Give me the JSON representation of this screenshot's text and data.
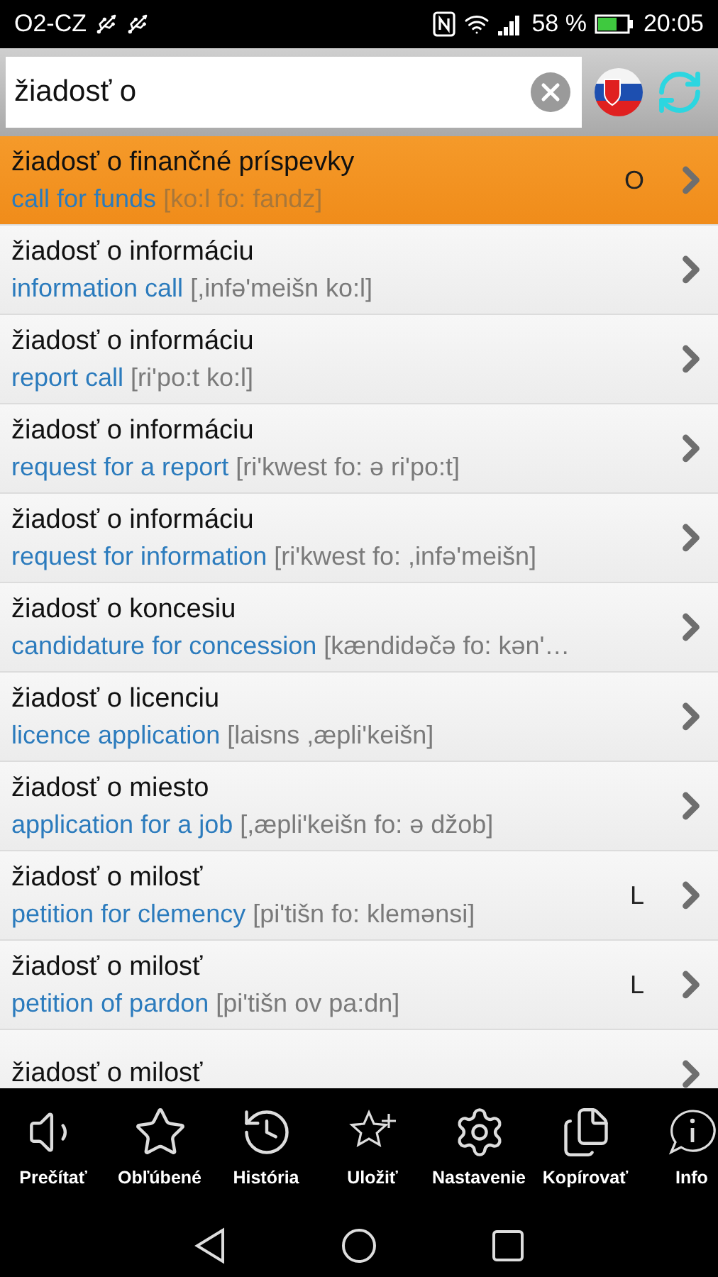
{
  "status_bar": {
    "carrier": "O2-CZ",
    "battery": "58 %",
    "time": "20:05"
  },
  "search": {
    "value": "žiadosť o"
  },
  "results": [
    {
      "headword": "žiadosť o finančné príspevky",
      "translation": "call for funds",
      "pronunciation": "[ko:l fo: fandz]",
      "tag": "O",
      "selected": true
    },
    {
      "headword": "žiadosť o informáciu",
      "translation": "information call",
      "pronunciation": "[,infə'meišn ko:l]",
      "selected": false
    },
    {
      "headword": "žiadosť o informáciu",
      "translation": "report call",
      "pronunciation": "[ri'po:t ko:l]",
      "selected": false
    },
    {
      "headword": "žiadosť o informáciu",
      "translation": "request for a report",
      "pronunciation": "[ri'kwest fo: ə ri'po:t]",
      "selected": false
    },
    {
      "headword": "žiadosť o informáciu",
      "translation": "request for information",
      "pronunciation": "[ri'kwest fo: ,infə'meišn]",
      "selected": false
    },
    {
      "headword": "žiadosť o koncesiu",
      "translation": "candidature for concession",
      "pronunciation": "[kændidəčə fo: kən'…",
      "selected": false
    },
    {
      "headword": "žiadosť o licenciu",
      "translation": "licence application",
      "pronunciation": "[laisns ,æpli'keišn]",
      "selected": false
    },
    {
      "headword": "žiadosť o miesto",
      "translation": "application for a job",
      "pronunciation": "[,æpli'keišn fo: ə džob]",
      "selected": false
    },
    {
      "headword": "žiadosť o milosť",
      "translation": "petition for clemency",
      "pronunciation": "[pi'tišn fo: klemənsi]",
      "tag": "L",
      "selected": false
    },
    {
      "headword": "žiadosť o milosť",
      "translation": "petition of pardon",
      "pronunciation": "[pi'tišn ov pa:dn]",
      "tag": "L",
      "selected": false
    },
    {
      "headword": "žiadosť o milosť",
      "selected": false
    }
  ],
  "toolbar": [
    {
      "label": "Prečítať"
    },
    {
      "label": "Obľúbené"
    },
    {
      "label": "História"
    },
    {
      "label": "Uložiť"
    },
    {
      "label": "Nastavenie"
    },
    {
      "label": "Kopírovať"
    },
    {
      "label": "Info"
    }
  ]
}
